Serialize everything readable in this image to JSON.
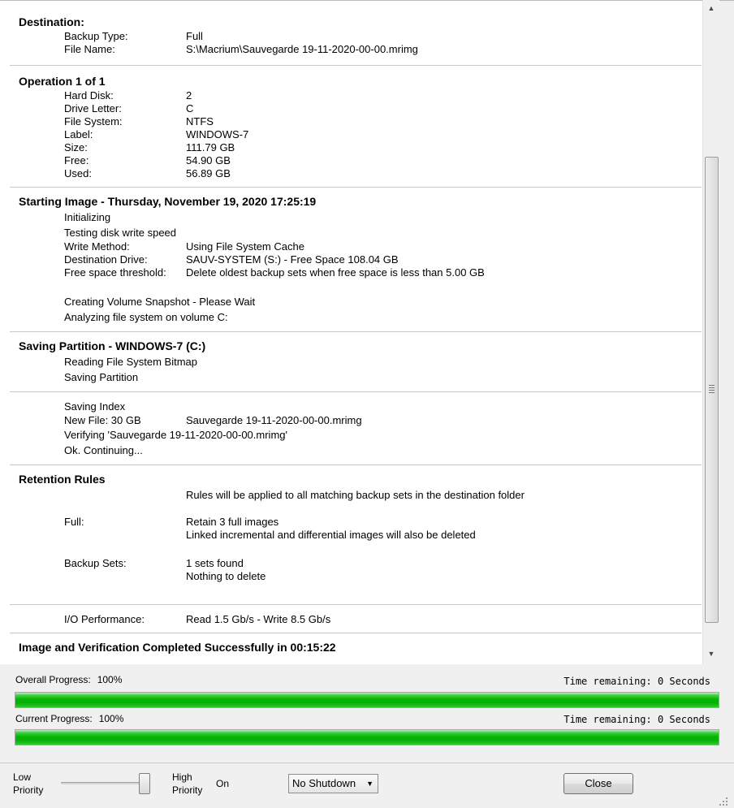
{
  "log": {
    "destination": {
      "title": "Destination:",
      "rows": [
        {
          "label": "Backup Type:",
          "value": "Full"
        },
        {
          "label": "File Name:",
          "value": "S:\\Macrium\\Sauvegarde 19-11-2020-00-00.mrimg"
        }
      ]
    },
    "operation": {
      "title": "Operation 1 of 1",
      "rows": [
        {
          "label": "Hard Disk:",
          "value": "2"
        },
        {
          "label": "Drive Letter:",
          "value": "C"
        },
        {
          "label": "File System:",
          "value": "NTFS"
        },
        {
          "label": "Label:",
          "value": "WINDOWS-7"
        },
        {
          "label": "Size:",
          "value": "111.79 GB"
        },
        {
          "label": "Free:",
          "value": "54.90 GB"
        },
        {
          "label": "Used:",
          "value": "56.89 GB"
        }
      ]
    },
    "starting": {
      "title": "Starting Image - Thursday, November 19, 2020 17:25:19",
      "line1": "Initializing",
      "line2": "Testing disk write speed",
      "rows": [
        {
          "label": "Write Method:",
          "value": "Using File System Cache"
        },
        {
          "label": "Destination Drive:",
          "value": "SAUV-SYSTEM (S:) - Free Space 108.04 GB"
        },
        {
          "label": "Free space threshold:",
          "value": "Delete oldest backup sets when free space is less than 5.00 GB"
        }
      ],
      "line3": "Creating Volume Snapshot - Please Wait",
      "line4": "Analyzing file system on volume C:"
    },
    "saving_partition": {
      "title": "Saving Partition - WINDOWS-7 (C:)",
      "line1": "Reading File System Bitmap",
      "line2": "Saving Partition"
    },
    "index": {
      "line1": "Saving Index",
      "new_file_label": "New File: 30 GB",
      "new_file_value": "Sauvegarde 19-11-2020-00-00.mrimg",
      "line2": "Verifying 'Sauvegarde 19-11-2020-00-00.mrimg'",
      "line3": "Ok. Continuing..."
    },
    "retention": {
      "title": "Retention Rules",
      "intro": "Rules will be applied to all matching backup sets in the destination folder",
      "full_label": "Full:",
      "full_value1": "Retain 3 full images",
      "full_value2": "Linked incremental and differential images will also be deleted",
      "sets_label": "Backup Sets:",
      "sets_value1": "1 sets found",
      "sets_value2": "Nothing to delete"
    },
    "io": {
      "label": "I/O Performance:",
      "value": "Read 1.5 Gb/s - Write 8.5 Gb/s"
    },
    "completed": "Image and Verification Completed Successfully in 00:15:22"
  },
  "progress": {
    "overall_label": "Overall Progress:",
    "overall_value": "100%",
    "overall_time": "Time remaining: 0 Seconds",
    "overall_fraction": 1.0,
    "current_label": "Current Progress:",
    "current_value": "100%",
    "current_time": "Time remaining: 0 Seconds",
    "current_fraction": 1.0,
    "color": "#06b106"
  },
  "controls": {
    "low": "Low",
    "priority": "Priority",
    "high": "High",
    "on": "On",
    "priority_level": 1.0,
    "shutdown_value": "No Shutdown",
    "close_label": "Close"
  }
}
